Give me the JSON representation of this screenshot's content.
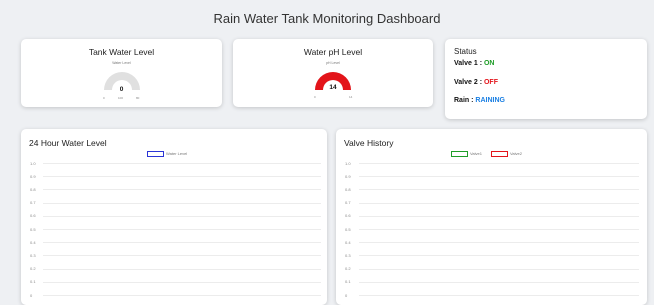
{
  "header": {
    "title": "Rain Water Tank Monitoring Dashboard"
  },
  "tank_level": {
    "title": "Tank Water Level",
    "gauge_label": "Water Level",
    "value": "0",
    "min_label": "0",
    "mid_label": "100",
    "max_label": "80",
    "fill_fraction": 0,
    "color": "#e0e0e0"
  },
  "ph_level": {
    "title": "Water pH Level",
    "gauge_label": "pH Level",
    "value": "14",
    "min_label": "0",
    "max_label": "14",
    "fill_fraction": 1,
    "color": "#e3141a"
  },
  "status": {
    "title": "Status",
    "valve1_label": "Valve 1 : ",
    "valve1_value": "ON",
    "valve1_color": "#1f9d28",
    "valve2_label": "Valve 2 : ",
    "valve2_value": "OFF",
    "valve2_color": "#e3141a",
    "rain_label": "Rain : ",
    "rain_value": "RAINING",
    "rain_color": "#1a7fe3"
  },
  "chart_data": [
    {
      "type": "line",
      "title": "24 Hour Water Level",
      "series": [
        {
          "name": "Water Level",
          "color": "#2b35d6",
          "values": []
        }
      ],
      "yticks": [
        "1.0",
        "0.9",
        "0.8",
        "0.7",
        "0.6",
        "0.5",
        "0.4",
        "0.3",
        "0.2",
        "0.1",
        "0"
      ],
      "ylim": [
        0,
        1
      ],
      "grid": true,
      "legend": "top-center"
    },
    {
      "type": "line",
      "title": "Valve History",
      "series": [
        {
          "name": "Valve1",
          "color": "#1f9d28",
          "values": []
        },
        {
          "name": "Valve2",
          "color": "#e3141a",
          "values": []
        }
      ],
      "yticks": [
        "1.0",
        "0.9",
        "0.8",
        "0.7",
        "0.6",
        "0.5",
        "0.4",
        "0.3",
        "0.2",
        "0.1",
        "0"
      ],
      "ylim": [
        0,
        1
      ],
      "grid": true,
      "legend": "top-center"
    }
  ]
}
